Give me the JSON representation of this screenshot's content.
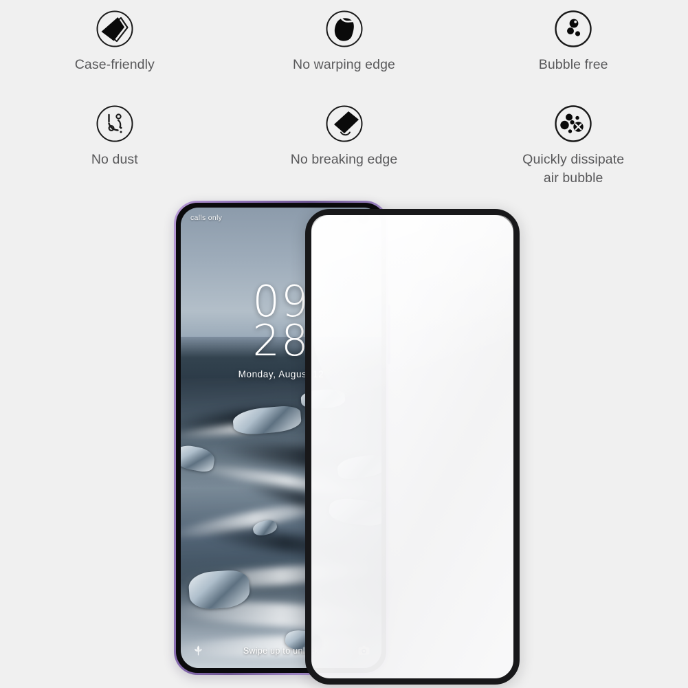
{
  "background_color": "#f0f0f0",
  "features": {
    "row1": [
      {
        "label": "Case-friendly",
        "icon": "case-friendly-icon"
      },
      {
        "label": "No warping edge",
        "icon": "no-warping-edge-icon"
      },
      {
        "label": "Bubble free",
        "icon": "bubble-free-icon"
      }
    ],
    "row2": [
      {
        "label": "No dust",
        "icon": "no-dust-icon"
      },
      {
        "label": "No breaking edge",
        "icon": "no-breaking-edge-icon"
      },
      {
        "label": "Quickly dissipate\nair bubble",
        "icon": "quickly-dissipate-air-bubble-icon"
      }
    ],
    "label_color": "#58585a"
  },
  "phone": {
    "frame_color": "#8f72b8",
    "statusbar": {
      "carrier": "calls only",
      "wifi_icon": "wifi-icon",
      "battery_icon": "battery-icon"
    },
    "lockscreen": {
      "hours": "09",
      "minutes": "28",
      "date": "Monday, August 12",
      "unlock_hint": "Swipe up to unlock",
      "left_icon": "assistant-flower-icon",
      "right_icon": "camera-icon"
    },
    "wallpaper": "ice-beach-long-exposure"
  },
  "glass": {
    "name": "tempered-glass-screen-protector",
    "border_color": "#18181a",
    "fill_color": "#f6f6f7"
  }
}
